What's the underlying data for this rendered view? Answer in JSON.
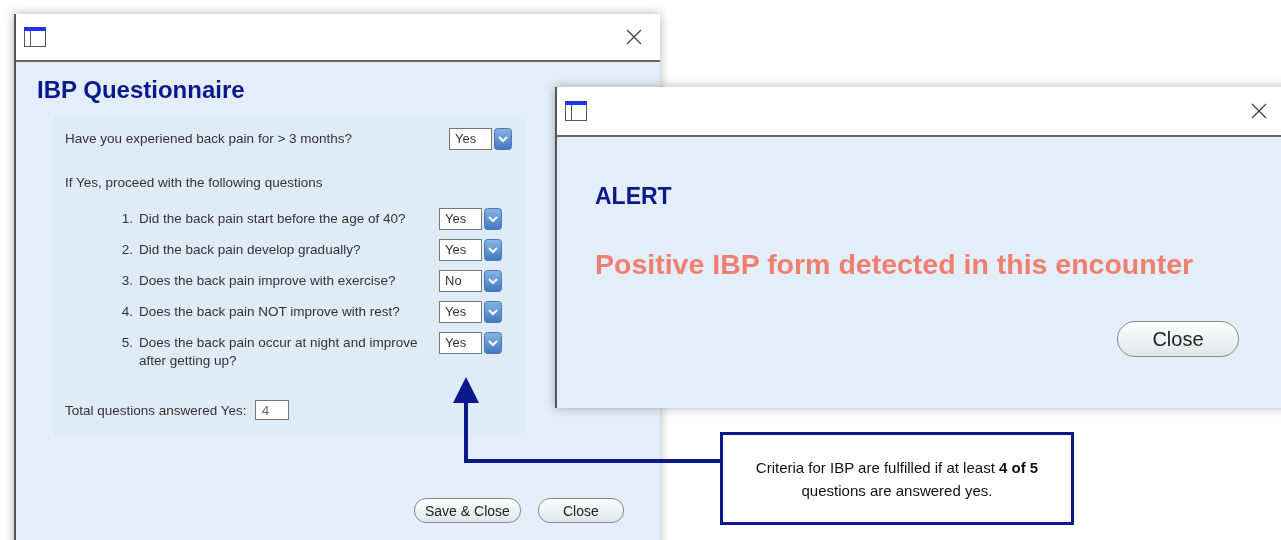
{
  "questionnaire": {
    "title": "IBP Questionnaire",
    "screening": {
      "question": "Have you experiened back pain for > 3 months?",
      "answer": "Yes"
    },
    "instruction": "If Yes, proceed with the following questions",
    "questions": [
      {
        "number": "1.",
        "text": "Did the back pain start before the age of 40?",
        "answer": "Yes"
      },
      {
        "number": "2.",
        "text": "Did the back pain develop gradually?",
        "answer": "Yes"
      },
      {
        "number": "3.",
        "text": "Does the back pain improve with exercise?",
        "answer": "No"
      },
      {
        "number": "4.",
        "text": "Does the back pain NOT improve with rest?",
        "answer": "Yes"
      },
      {
        "number": "5.",
        "text": "Does the back pain occur at night and improve after getting up?",
        "answer": "Yes"
      }
    ],
    "total_label": "Total questions answered Yes:",
    "total_value": "4",
    "buttons": [
      "Save & Close",
      "Close"
    ]
  },
  "alert": {
    "heading": "ALERT",
    "message": "Positive IBP form detected in this encounter",
    "button": "Close"
  },
  "callout": {
    "text": "Criteria for IBP are fulfilled if at least **4 of 5** questions are answered yes."
  }
}
